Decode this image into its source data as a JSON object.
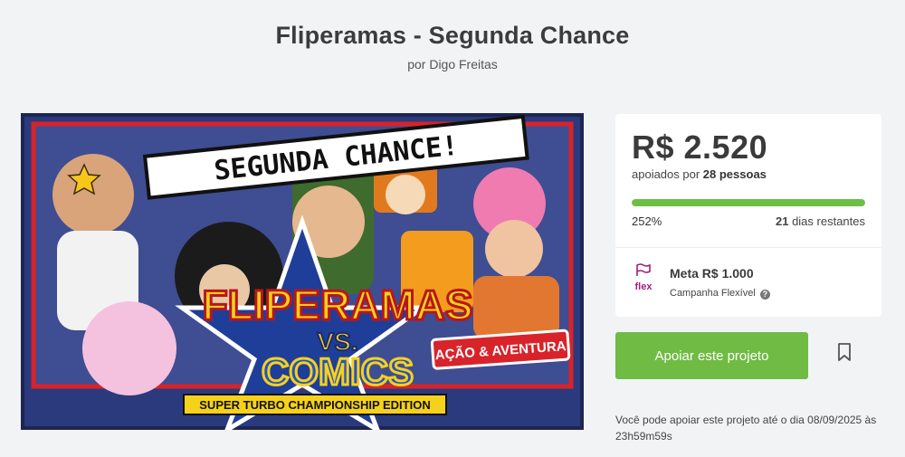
{
  "header": {
    "title": "Fliperamas - Segunda Chance",
    "byline": "por Digo Freitas"
  },
  "art": {
    "banner_text": "SEGUNDA CHANCE!",
    "logo_line1": "FLIPERAMAS",
    "logo_vs": "VS.",
    "logo_line2": "COMICS",
    "subtitle": "SUPER TURBO CHAMPIONSHIP EDITION",
    "badge": "AÇÃO & AVENTURA"
  },
  "stats": {
    "amount": "R$ 2.520",
    "backers_prefix": "apoiados por",
    "backers_count": "28 pessoas",
    "percent": "252%",
    "progress_fraction": 1.0,
    "days_count": "21",
    "days_suffix": "dias restantes",
    "flex_label": "flex",
    "goal": "Meta R$ 1.000",
    "campaign_type": "Campanha Flexível",
    "help_glyph": "?"
  },
  "actions": {
    "support_label": "Apoiar este projeto",
    "deadline_text": "Você pode apoiar este projeto até o dia 08/09/2025 às 23h59m59s"
  },
  "colors": {
    "accent_green": "#70bb43",
    "flex_magenta": "#a3207e",
    "background": "#f1f3f5"
  },
  "icons": {
    "bookmark": "bookmark-icon",
    "flex": "flex-icon",
    "help": "help-icon"
  }
}
